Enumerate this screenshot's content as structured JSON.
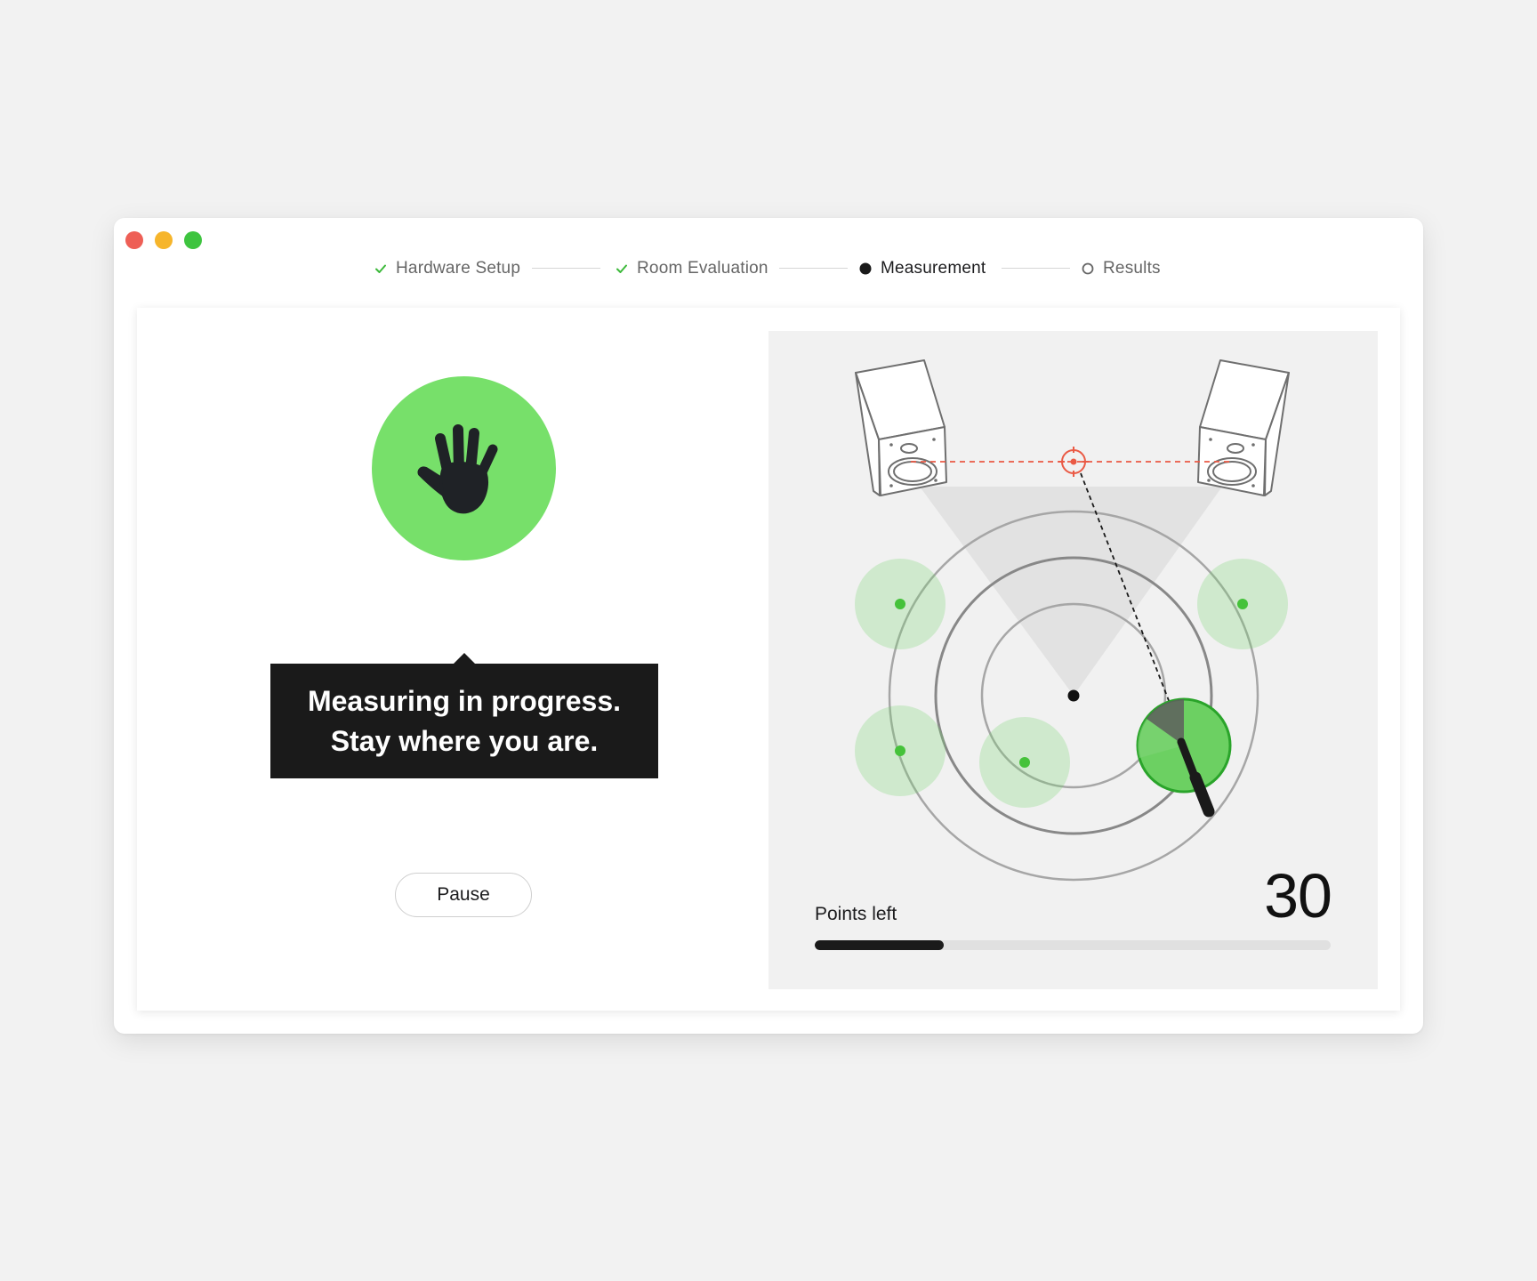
{
  "window": {
    "traffic_lights": [
      {
        "name": "close",
        "color": "#ee5f56"
      },
      {
        "name": "minimize",
        "color": "#f6b52b"
      },
      {
        "name": "zoom",
        "color": "#3ec43f"
      }
    ]
  },
  "steps": [
    {
      "label": "Hardware Setup",
      "state": "done",
      "icon": "check-icon"
    },
    {
      "label": "Room Evaluation",
      "state": "done",
      "icon": "check-icon"
    },
    {
      "label": "Measurement",
      "state": "active",
      "icon": "filled-dot-icon"
    },
    {
      "label": "Results",
      "state": "pending",
      "icon": "empty-circle-icon"
    }
  ],
  "status": {
    "icon": "stop-hand-icon",
    "message_line1": "Measuring in progress.",
    "message_line2": "Stay where you are."
  },
  "controls": {
    "pause_label": "Pause"
  },
  "measurement": {
    "points_left_label": "Points left",
    "points_left": "30",
    "progress_fraction": 0.25,
    "measured_points": 5,
    "icons": [
      "speaker-left-icon",
      "speaker-right-icon",
      "target-crosshair-icon",
      "microphone-icon",
      "listening-position-icon"
    ]
  },
  "colors": {
    "accent_green": "#77e06a",
    "point_green": "#45c23a",
    "target_red": "#ea5a45",
    "dark": "#1a1a1a"
  }
}
